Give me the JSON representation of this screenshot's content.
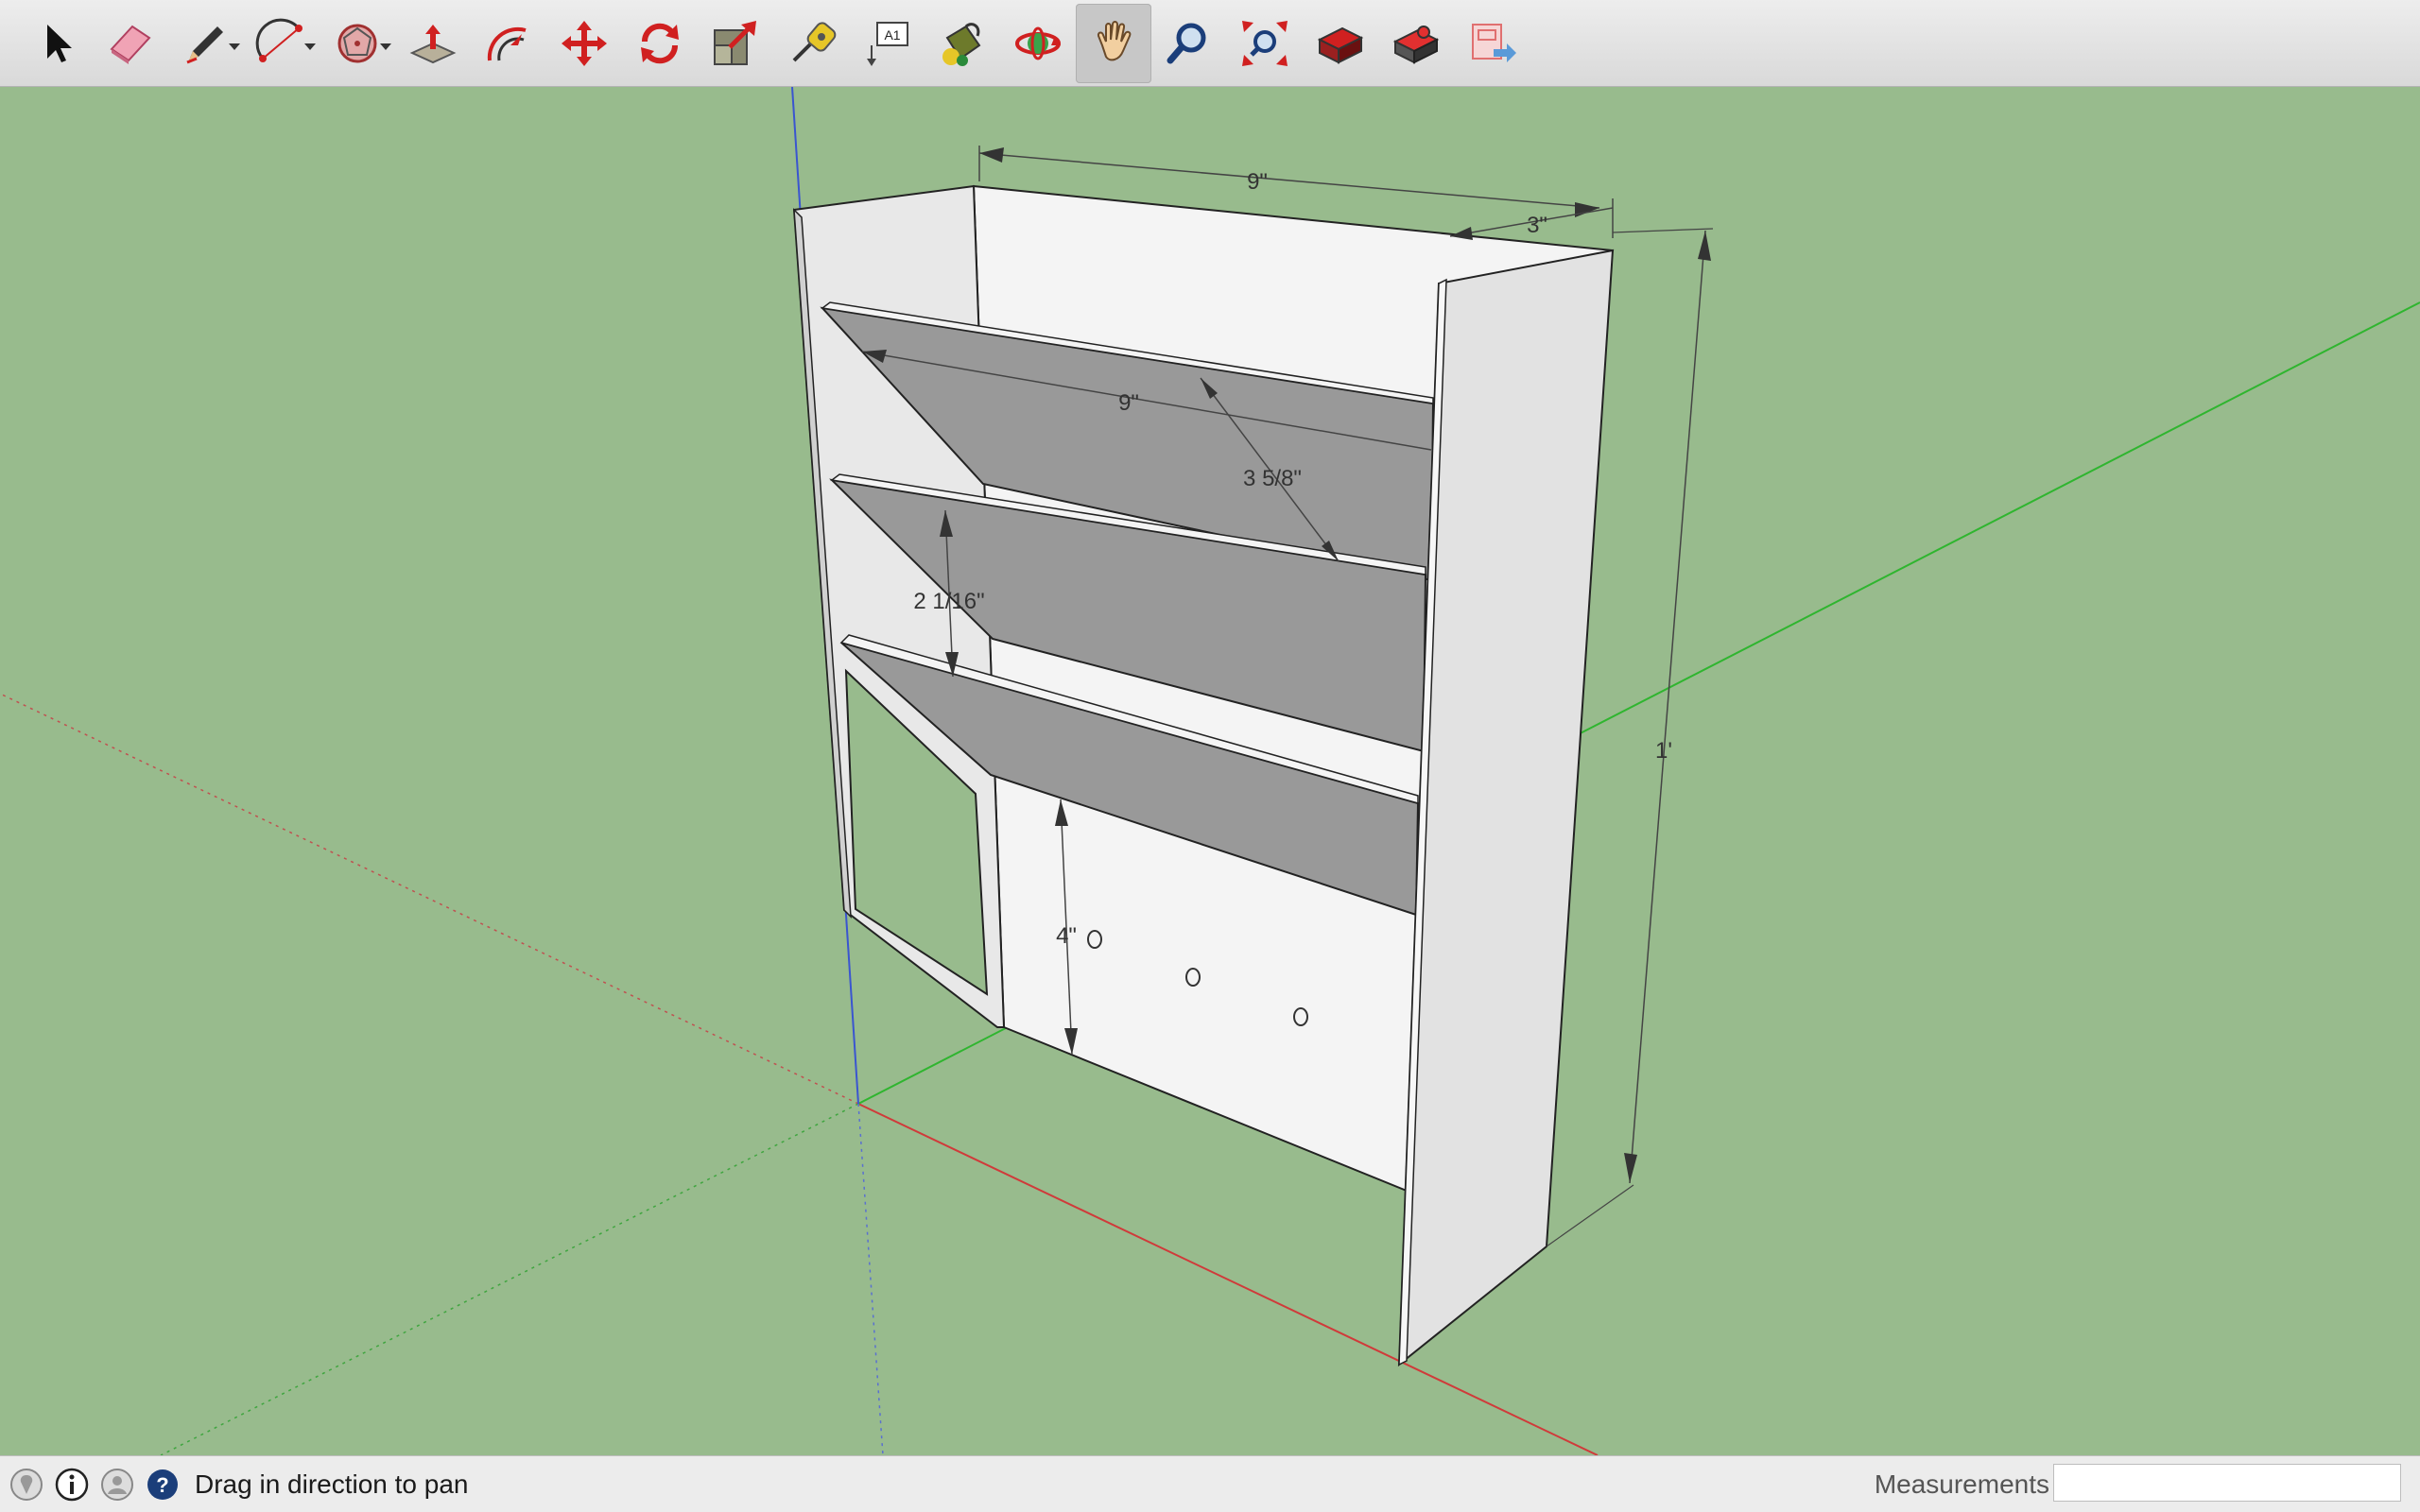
{
  "toolbar": {
    "tools": [
      {
        "name": "select-tool",
        "icon": "arrow-pointer-icon"
      },
      {
        "name": "eraser-tool",
        "icon": "eraser-icon"
      },
      {
        "name": "line-tool",
        "icon": "pencil-icon",
        "dropdown": true
      },
      {
        "name": "arc-tool",
        "icon": "arc-icon",
        "dropdown": true
      },
      {
        "name": "shapes-tool",
        "icon": "polygon-icon",
        "dropdown": true
      },
      {
        "name": "push-pull-tool",
        "icon": "push-pull-icon"
      },
      {
        "name": "offset-tool",
        "icon": "offset-icon"
      },
      {
        "name": "move-tool",
        "icon": "move-arrows-icon"
      },
      {
        "name": "rotate-tool",
        "icon": "rotate-icon"
      },
      {
        "name": "scale-tool",
        "icon": "scale-icon"
      },
      {
        "name": "tape-measure-tool",
        "icon": "tape-measure-icon"
      },
      {
        "name": "text-tool",
        "icon": "text-label-icon"
      },
      {
        "name": "paint-bucket-tool",
        "icon": "paint-bucket-icon"
      },
      {
        "name": "orbit-tool",
        "icon": "orbit-icon"
      },
      {
        "name": "pan-tool",
        "icon": "hand-icon",
        "active": true
      },
      {
        "name": "zoom-tool",
        "icon": "magnifier-icon"
      },
      {
        "name": "zoom-extents-tool",
        "icon": "zoom-extents-icon"
      },
      {
        "name": "warehouse-tool",
        "icon": "warehouse-icon"
      },
      {
        "name": "extension-warehouse-tool",
        "icon": "extension-warehouse-icon"
      },
      {
        "name": "send-to-layout-tool",
        "icon": "layout-icon"
      }
    ],
    "text_tool_label": "A1"
  },
  "model": {
    "dimensions": {
      "top_width": "9\"",
      "top_depth": "3\"",
      "height": "1'",
      "shelf_width": "9\"",
      "shelf_depth": "3 5/8\"",
      "shelf_spacing": "2 1/16\"",
      "bottom_gap": "4\""
    },
    "colors": {
      "ground": "#98bb8d",
      "panel_light": "#f4f4f4",
      "panel_side": "#e2e2e2",
      "shelf_gray": "#999999",
      "axis_red": "#d03a3a",
      "axis_green": "#2fb52f",
      "axis_blue": "#3a55d0"
    }
  },
  "statusbar": {
    "icons": [
      "geo-location-icon",
      "credits-info-icon",
      "user-account-icon",
      "help-icon"
    ],
    "status_text": "Drag in direction to pan",
    "measurements_label": "Measurements",
    "measurements_value": ""
  }
}
